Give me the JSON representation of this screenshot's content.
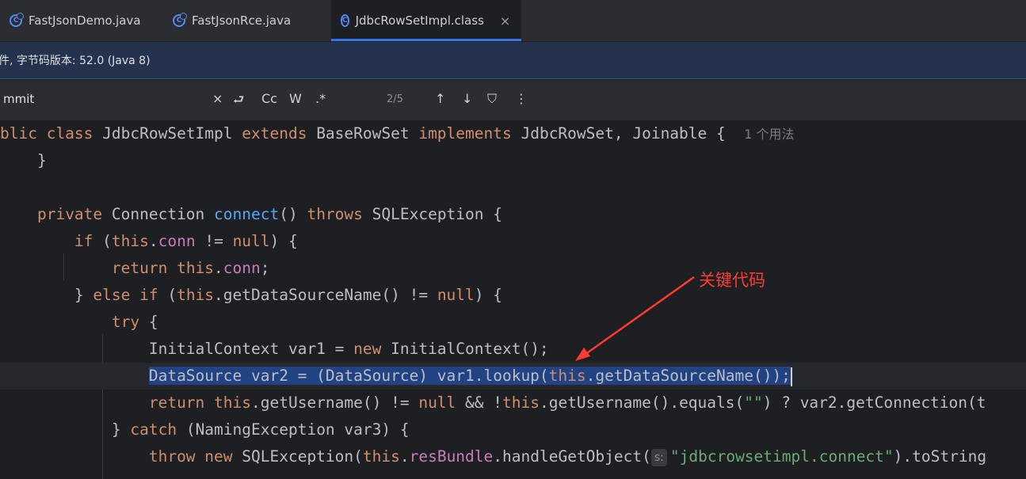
{
  "tabs": [
    {
      "label": "FastJsonDemo.java",
      "icon": "java-class-icon",
      "active": false
    },
    {
      "label": "FastJsonRce.java",
      "icon": "java-class-icon",
      "active": false
    },
    {
      "label": "JdbcRowSetImpl.class",
      "icon": "class-file-icon",
      "active": true
    }
  ],
  "tab_close_glyph": "×",
  "banner": {
    "text": "件, 字节码版本: 52.0 (Java 8)"
  },
  "find": {
    "query": "mmit",
    "clear_glyph": "×",
    "match_count": "2/5",
    "options": {
      "newline": "⮐",
      "match_case": "Cc",
      "words": "W",
      "regex": ".*"
    },
    "nav": {
      "prev": "↑",
      "next": "↓",
      "filter": "⛉",
      "more": "⋮"
    }
  },
  "code": {
    "l1": {
      "a": "blic ",
      "b": "class ",
      "c": "JdbcRowSetImpl ",
      "d": "extends ",
      "e": "BaseRowSet ",
      "f": "implements ",
      "g": "JdbcRowSet, Joinable {  ",
      "hint": "1 个用法"
    },
    "l2": {
      "a": "    }"
    },
    "l3": {
      "a": ""
    },
    "l4": {
      "a": "    ",
      "b": "private ",
      "c": "Connection ",
      "d": "connect",
      "e": "() ",
      "f": "throws ",
      "g": "SQLException {"
    },
    "l5": {
      "a": "        ",
      "b": "if ",
      "c": "(",
      "d": "this",
      "e": ".",
      "f": "conn",
      "g": " != ",
      "h": "null",
      "i": ") {"
    },
    "l6": {
      "a": "            ",
      "b": "return ",
      "c": "this",
      "d": ".",
      "e": "conn",
      "f": ";"
    },
    "l7": {
      "a": "        } ",
      "b": "else if ",
      "c": "(",
      "d": "this",
      "e": ".getDataSourceName() != ",
      "f": "null",
      "g": ") {"
    },
    "l8": {
      "a": "            ",
      "b": "try ",
      "c": "{"
    },
    "l9": {
      "a": "                InitialContext var1 = ",
      "b": "new ",
      "c": "InitialContext();"
    },
    "l10": {
      "a": "                ",
      "b": "DataSource var2 = (DataSource) var1.lookup(",
      "c": "this",
      "d": ".getDataSourceName());"
    },
    "l11": {
      "a": "                ",
      "b": "return ",
      "c": "this",
      "d": ".getUsername() != ",
      "e": "null",
      "f": " && !",
      "g": "this",
      "h": ".getUsername().equals(",
      "i": "\"\"",
      "j": ") ? var2.getConnection(t"
    },
    "l12": {
      "a": "            } ",
      "b": "catch ",
      "c": "(NamingException var3) {"
    },
    "l13": {
      "a": "                ",
      "b": "throw ",
      "c": "new ",
      "d": "SQLException(",
      "e": "this",
      "f": ".",
      "g": "resBundle",
      "h": ".handleGetObject(",
      "pill": "s:",
      "i": "\"jdbcrowsetimpl.connect\"",
      "j": ").toString"
    }
  },
  "annotation": {
    "text": "关键代码",
    "color": "#ff3b30"
  }
}
